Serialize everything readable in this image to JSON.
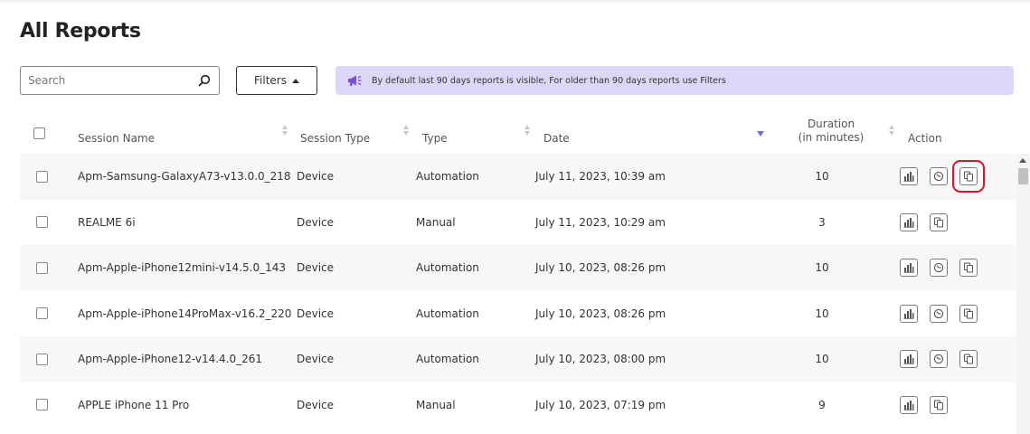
{
  "page": {
    "title": "All Reports"
  },
  "search": {
    "placeholder": "Search",
    "value": ""
  },
  "filters": {
    "label": "Filters"
  },
  "banner": {
    "text": "By default last 90 days reports is visible, For older than 90 days reports use Filters",
    "color": "#ddd6f7"
  },
  "table": {
    "columns": {
      "session_name": "Session Name",
      "session_type": "Session Type",
      "type": "Type",
      "date": "Date",
      "duration_line1": "Duration",
      "duration_line2": "(in minutes)",
      "action": "Action"
    },
    "rows": [
      {
        "session_name": "Apm-Samsung-GalaxyA73-v13.0.0_218",
        "session_type": "Device",
        "type": "Automation",
        "date": "July 11, 2023, 10:39 am",
        "duration": "10",
        "actions": [
          "chart-icon",
          "gauge-icon",
          "copy-icon"
        ],
        "highlighted_action": "copy-icon"
      },
      {
        "session_name": "REALME 6i",
        "session_type": "Device",
        "type": "Manual",
        "date": "July 11, 2023, 10:29 am",
        "duration": "3",
        "actions": [
          "chart-icon",
          "copy-icon"
        ]
      },
      {
        "session_name": "Apm-Apple-iPhone12mini-v14.5.0_143",
        "session_type": "Device",
        "type": "Automation",
        "date": "July 10, 2023, 08:26 pm",
        "duration": "10",
        "actions": [
          "chart-icon",
          "gauge-icon",
          "copy-icon"
        ]
      },
      {
        "session_name": "Apm-Apple-iPhone14ProMax-v16.2_220",
        "session_type": "Device",
        "type": "Automation",
        "date": "July 10, 2023, 08:26 pm",
        "duration": "10",
        "actions": [
          "chart-icon",
          "gauge-icon",
          "copy-icon"
        ]
      },
      {
        "session_name": "Apm-Apple-iPhone12-v14.4.0_261",
        "session_type": "Device",
        "type": "Automation",
        "date": "July 10, 2023, 08:00 pm",
        "duration": "10",
        "actions": [
          "chart-icon",
          "gauge-icon",
          "copy-icon"
        ]
      },
      {
        "session_name": "APPLE iPhone 11 Pro",
        "session_type": "Device",
        "type": "Manual",
        "date": "July 10, 2023, 07:19 pm",
        "duration": "9",
        "actions": [
          "chart-icon",
          "copy-icon"
        ]
      }
    ]
  },
  "colors": {
    "accent_sort": "#6b6fcf",
    "highlight": "#e0102a",
    "row_alt": "#f7f7f7"
  }
}
